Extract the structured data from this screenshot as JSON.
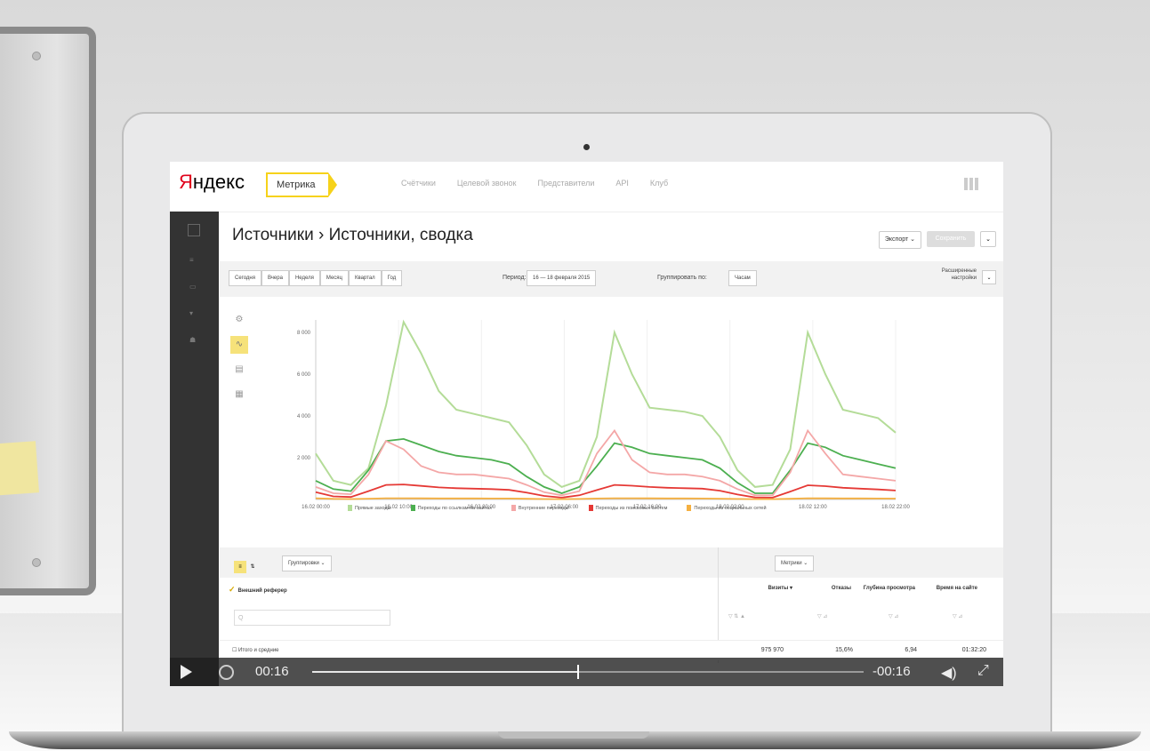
{
  "header": {
    "logo": "Яндекс",
    "product": "Метрика",
    "nav": [
      "Счётчики",
      "Целевой звонок",
      "Представители",
      "API",
      "Клуб"
    ]
  },
  "page": {
    "title": "Источники › Источники, сводка",
    "export_label": "Экспорт",
    "save_label": "Сохранить"
  },
  "toolbar": {
    "period_buttons": [
      "Сегодня",
      "Вчера",
      "Неделя",
      "Месяц",
      "Квартал",
      "Год"
    ],
    "period_label": "Период:",
    "period_value": "16 — 18 февраля 2015",
    "group_label": "Группировать по:",
    "group_value": "Часам",
    "advanced_label": "Расширенные настройки"
  },
  "chart_data": {
    "type": "line",
    "x": [
      "16.02 00:00",
      "16.02 10:00",
      "16.02 20:00",
      "17.02 06:00",
      "17.02 16:00",
      "18.02 02:00",
      "18.02 12:00",
      "18.02 22:00"
    ],
    "y_ticks": [
      "2 000",
      "4 000",
      "6 000",
      "8 000"
    ],
    "ylim": [
      0,
      8600
    ],
    "series": [
      {
        "name": "Прямые заходы",
        "color": "#b4dc98",
        "values": [
          2200,
          900,
          700,
          1500,
          4500,
          8500,
          7000,
          5200,
          4300,
          4100,
          3900,
          3700,
          2600,
          1200,
          600,
          900,
          3000,
          8000,
          6000,
          4400,
          4300,
          4200,
          4000,
          3000,
          1400,
          600,
          700,
          2400,
          8000,
          6000,
          4300,
          4100,
          3900,
          3200
        ]
      },
      {
        "name": "Переходы по ссылкам на сайтах",
        "color": "#4caf50",
        "values": [
          900,
          500,
          400,
          1400,
          2800,
          2900,
          2600,
          2300,
          2100,
          2000,
          1900,
          1700,
          1100,
          600,
          300,
          600,
          1600,
          2700,
          2500,
          2200,
          2100,
          2000,
          1900,
          1500,
          800,
          300,
          300,
          1400,
          2700,
          2500,
          2100,
          1900,
          1700,
          1500
        ]
      },
      {
        "name": "Внутренние переходы",
        "color": "#f4a7a7",
        "values": [
          600,
          300,
          250,
          1200,
          2800,
          2400,
          1600,
          1300,
          1200,
          1200,
          1100,
          1000,
          700,
          350,
          200,
          400,
          2200,
          3300,
          1900,
          1300,
          1200,
          1200,
          1100,
          900,
          500,
          200,
          200,
          1300,
          3300,
          2200,
          1200,
          1100,
          1000,
          900
        ]
      },
      {
        "name": "Переходы из поисковых систем",
        "color": "#e53935",
        "values": [
          350,
          150,
          120,
          400,
          700,
          720,
          650,
          580,
          540,
          520,
          500,
          460,
          330,
          170,
          90,
          200,
          450,
          700,
          660,
          600,
          560,
          540,
          520,
          420,
          240,
          100,
          90,
          380,
          680,
          640,
          560,
          520,
          480,
          430
        ]
      },
      {
        "name": "Переходы из социальных сетей",
        "color": "#f5b041",
        "values": [
          60,
          30,
          20,
          40,
          60,
          60,
          55,
          50,
          50,
          50,
          48,
          45,
          35,
          20,
          15,
          25,
          45,
          60,
          58,
          54,
          52,
          50,
          48,
          40,
          25,
          15,
          15,
          35,
          58,
          56,
          52,
          50,
          46,
          42
        ]
      }
    ]
  },
  "table": {
    "grouping_label": "Группировки",
    "metrics_label": "Метрики",
    "dimension": "Внешний реферер",
    "search_placeholder": "Q",
    "columns": [
      "Визиты",
      "Отказы",
      "Глубина просмотра",
      "Время на сайте"
    ],
    "totals_label": "Итого и средние",
    "totals": [
      "975 970",
      "15,6%",
      "6,94",
      "01:32:20"
    ]
  },
  "player": {
    "elapsed": "00:16",
    "remaining": "-00:16",
    "progress": 0.48
  }
}
